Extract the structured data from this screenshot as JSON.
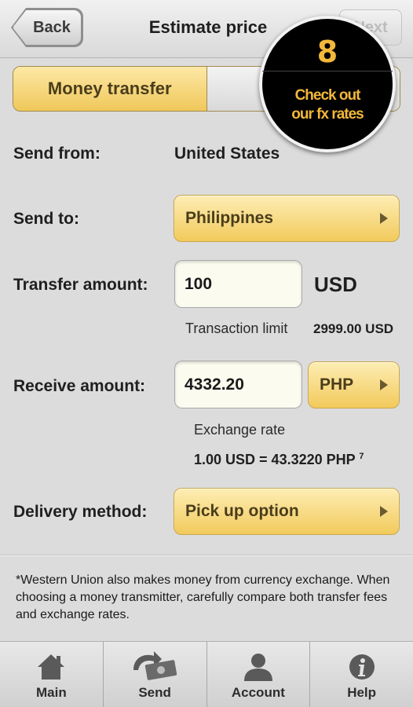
{
  "nav": {
    "back_label": "Back",
    "title": "Estimate price",
    "next_label": "Next"
  },
  "segment": {
    "active_label": "Money transfer"
  },
  "promo": {
    "number": "8",
    "line1": "Check out",
    "line2": "our fx rates"
  },
  "form": {
    "send_from": {
      "label": "Send from:",
      "value": "United States"
    },
    "send_to": {
      "label": "Send to:",
      "value": "Philippines"
    },
    "transfer_amount": {
      "label": "Transfer amount:",
      "value": "100",
      "currency": "USD"
    },
    "transaction_limit": {
      "label": "Transaction limit",
      "value": "2999.00 USD"
    },
    "receive_amount": {
      "label": "Receive amount:",
      "value": "4332.20",
      "currency": "PHP"
    },
    "exchange_rate": {
      "label": "Exchange rate",
      "value": "1.00 USD = 43.3220 PHP",
      "footnote": "7"
    },
    "delivery_method": {
      "label": "Delivery method:",
      "value": "Pick up option"
    }
  },
  "disclaimer": "*Western Union also makes money from currency exchange. When choosing a money transmitter, carefully compare both transfer fees and exchange rates.",
  "tabs": [
    {
      "label": "Main",
      "icon": "house-icon"
    },
    {
      "label": "Send",
      "icon": "send-money-icon"
    },
    {
      "label": "Account",
      "icon": "person-icon"
    },
    {
      "label": "Help",
      "icon": "info-icon"
    }
  ],
  "colors": {
    "gold": "#f2ca5c",
    "gold_light": "#fdedb4",
    "promo_text": "#f3b83a",
    "background": "#dcdcdc"
  }
}
